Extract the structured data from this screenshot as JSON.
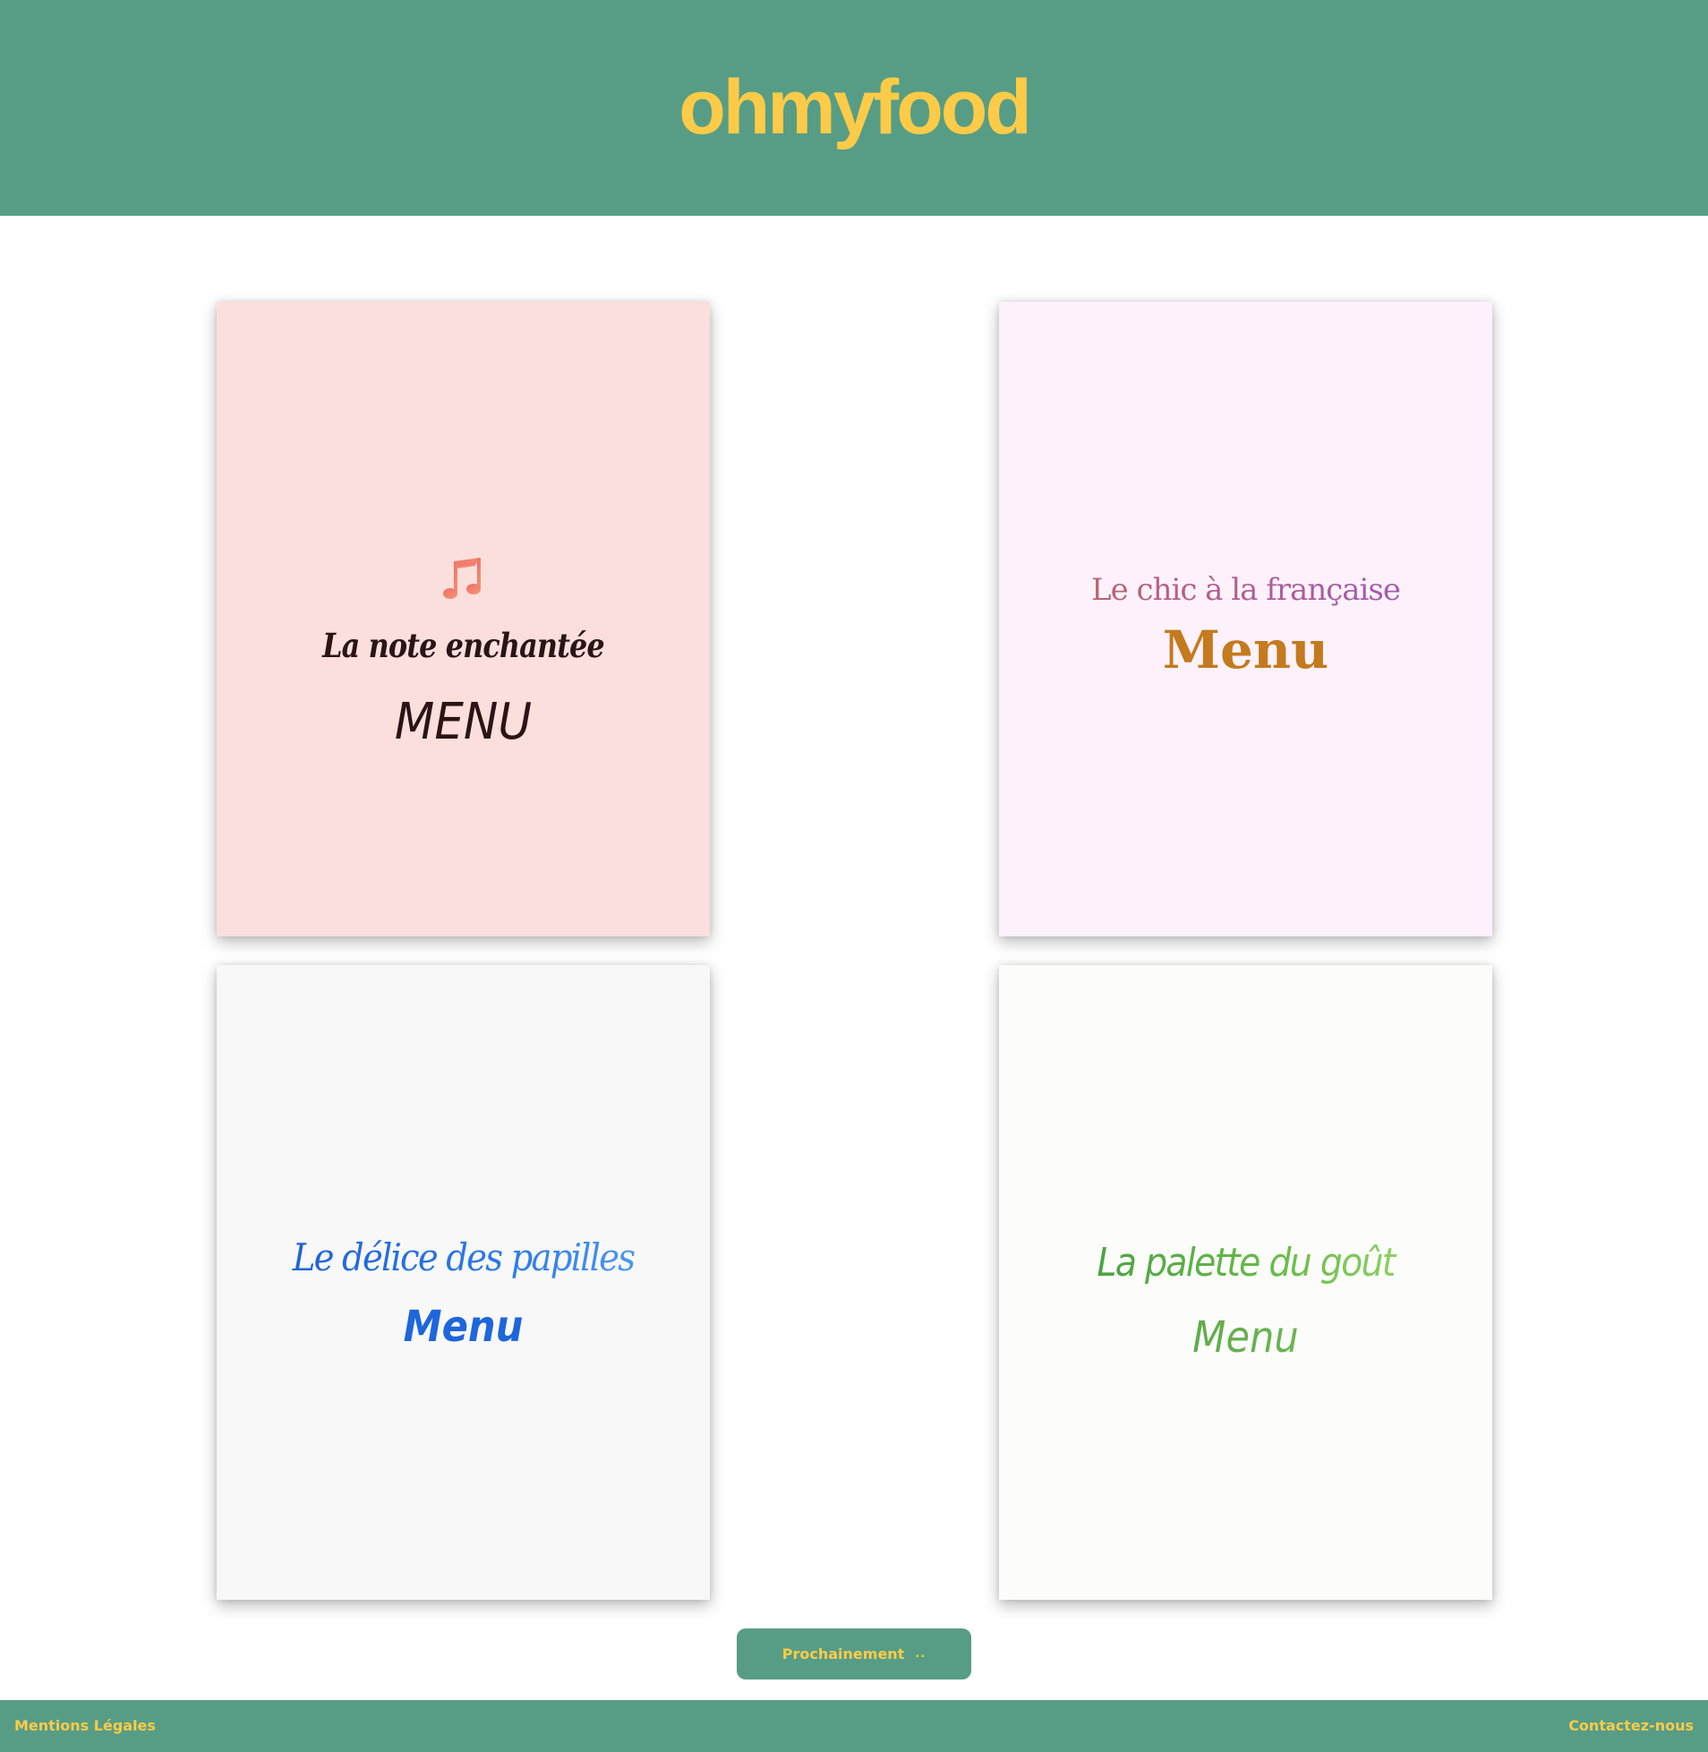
{
  "header": {
    "logo": "ohmyfood"
  },
  "colors": {
    "brand_green": "#579d86",
    "brand_yellow": "#fdcb48"
  },
  "cards": [
    {
      "icon": "music-note-icon",
      "title": "La note enchantée",
      "menu": "MENU",
      "background": "#fbdfdc"
    },
    {
      "title": "Le chic à la française",
      "menu": "Menu",
      "background": "#fdf2fb"
    },
    {
      "title": "Le délice des papilles",
      "menu": "Menu",
      "background": "#f8f8f8"
    },
    {
      "title": "La palette du goût",
      "menu": "Menu",
      "background": "#fcfdfb"
    }
  ],
  "soon_button": {
    "label": "Prochainement",
    "dots": ".."
  },
  "footer": {
    "legal": "Mentions Légales",
    "contact": "Contactez-nous"
  }
}
